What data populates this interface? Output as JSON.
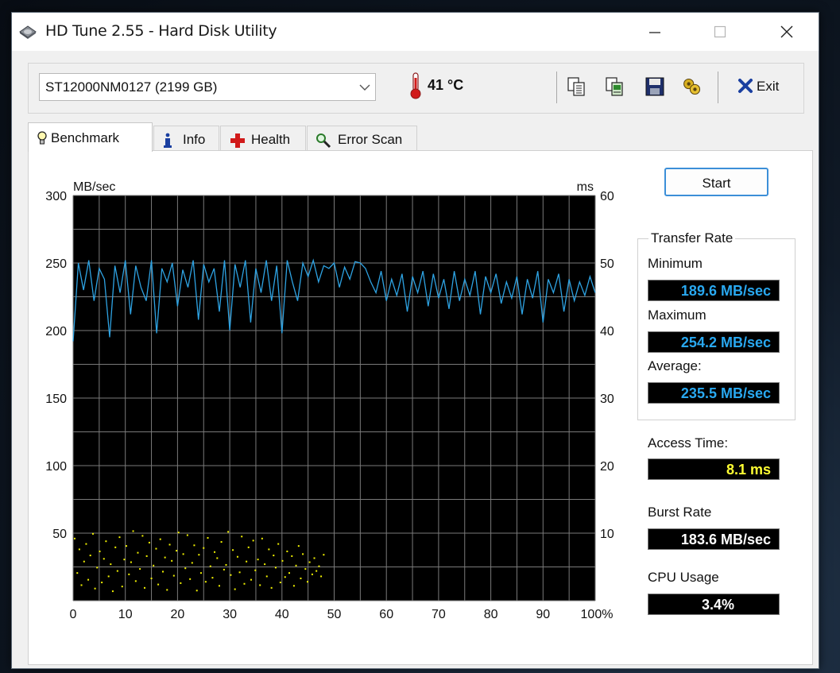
{
  "window": {
    "title": "HD Tune 2.55 - Hard Disk Utility",
    "minimize_glyph": "—",
    "close_glyph": "✕"
  },
  "toolbar": {
    "drive_select": "ST12000NM0127 (2199 GB)",
    "temperature": "41 °C",
    "icons": [
      "copy-text-icon",
      "copy-screenshot-icon",
      "save-icon",
      "options-icon"
    ],
    "exit_label": "Exit"
  },
  "tabs": [
    {
      "label": "Benchmark",
      "icon": "lightbulb-icon",
      "active": true
    },
    {
      "label": "Info",
      "icon": "info-icon",
      "active": false
    },
    {
      "label": "Health",
      "icon": "health-cross-icon",
      "active": false
    },
    {
      "label": "Error Scan",
      "icon": "magnifier-icon",
      "active": false
    }
  ],
  "benchmark": {
    "start_label": "Start",
    "transfer_rate_title": "Transfer Rate",
    "minimum_label": "Minimum",
    "minimum_value": "189.6 MB/sec",
    "maximum_label": "Maximum",
    "maximum_value": "254.2 MB/sec",
    "average_label": "Average:",
    "average_value": "235.5 MB/sec",
    "access_label": "Access Time:",
    "access_value": "8.1 ms",
    "burst_label": "Burst Rate",
    "burst_value": "183.6 MB/sec",
    "cpu_label": "CPU Usage",
    "cpu_value": "3.4%",
    "colors": {
      "transfer_line": "#2ea3e3",
      "access_dots": "#f0f000",
      "rate_values": "#29a8f0",
      "access_value": "#ffff33",
      "plain_values": "#ffffff"
    }
  },
  "chart_data": {
    "type": "line",
    "left_unit": "MB/sec",
    "right_unit": "ms",
    "x_suffix": "%",
    "xlim": [
      0,
      100
    ],
    "ylim": [
      0,
      300
    ],
    "y2lim": [
      0,
      60
    ],
    "x_ticks": [
      0,
      10,
      20,
      30,
      40,
      50,
      60,
      70,
      80,
      90,
      100
    ],
    "y_ticks": [
      50,
      100,
      150,
      200,
      250,
      300
    ],
    "y2_ticks": [
      10,
      20,
      30,
      40,
      50,
      60
    ],
    "grid": true,
    "series": [
      {
        "kind": "line",
        "x": [
          0,
          1,
          2,
          3,
          4,
          5,
          6,
          7,
          8,
          9,
          10,
          11,
          12,
          13,
          14,
          15,
          16,
          17,
          18,
          19,
          20,
          21,
          22,
          23,
          24,
          25,
          26,
          27,
          28,
          29,
          30,
          31,
          32,
          33,
          34,
          35,
          36,
          37,
          38,
          39,
          40,
          41,
          42,
          43,
          44,
          45,
          46,
          47,
          48,
          49,
          50,
          51,
          52,
          53,
          54,
          55,
          56,
          57,
          58,
          59,
          60,
          61,
          62,
          63,
          64,
          65,
          66,
          67,
          68,
          69,
          70,
          71,
          72,
          73,
          74,
          75,
          76,
          77,
          78,
          79,
          80,
          81,
          82,
          83,
          84,
          85,
          86,
          87,
          88,
          89,
          90,
          91,
          92,
          93,
          94,
          95,
          96,
          97,
          98,
          99,
          100
        ],
        "y": [
          192,
          250,
          230,
          252,
          222,
          246,
          238,
          195,
          248,
          228,
          252,
          212,
          248,
          232,
          222,
          252,
          198,
          246,
          236,
          250,
          218,
          245,
          232,
          252,
          208,
          249,
          236,
          246,
          214,
          252,
          200,
          249,
          232,
          252,
          206,
          246,
          228,
          252,
          222,
          248,
          198,
          252,
          236,
          222,
          250,
          240,
          252,
          236,
          248,
          246,
          250,
          232,
          247,
          238,
          251,
          250,
          246,
          236,
          228,
          244,
          222,
          238,
          226,
          242,
          214,
          240,
          228,
          244,
          218,
          242,
          224,
          238,
          216,
          244,
          222,
          238,
          226,
          244,
          212,
          240,
          228,
          242,
          220,
          236,
          224,
          240,
          212,
          238,
          224,
          244,
          206,
          238,
          228,
          242,
          214,
          238,
          222,
          236,
          226,
          240,
          228
        ]
      },
      {
        "kind": "scatter",
        "x": [
          0.3,
          0.8,
          1.2,
          1.6,
          2.1,
          2.5,
          2.9,
          3.3,
          3.8,
          4.2,
          4.6,
          5.1,
          5.5,
          5.9,
          6.3,
          6.8,
          7.2,
          7.6,
          8.1,
          8.5,
          8.9,
          9.4,
          9.8,
          10.2,
          10.7,
          11.1,
          11.5,
          12,
          12.4,
          12.8,
          13.3,
          13.7,
          14.1,
          14.6,
          15,
          15.4,
          15.9,
          16.3,
          16.7,
          17.2,
          17.6,
          18,
          18.5,
          18.9,
          19.3,
          19.8,
          20.2,
          20.6,
          21.1,
          21.5,
          21.9,
          22.4,
          22.8,
          23.2,
          23.7,
          24.1,
          24.5,
          25,
          25.4,
          25.8,
          26.3,
          26.7,
          27.1,
          27.6,
          28,
          28.4,
          28.9,
          29.3,
          29.7,
          30.2,
          30.6,
          31,
          31.5,
          31.9,
          32.3,
          32.8,
          33.2,
          33.6,
          34.1,
          34.5,
          34.9,
          35.4,
          35.8,
          36.2,
          36.7,
          37.1,
          37.5,
          38,
          38.4,
          38.8,
          39.3,
          39.7,
          40.1,
          40.6,
          41,
          41.4,
          41.9,
          42.3,
          42.7,
          43.2,
          43.6,
          44,
          44.5,
          44.9,
          45.3,
          45.8,
          46.2,
          46.6,
          47.1,
          47.5,
          48
        ],
        "y": [
          9.2,
          4.1,
          7.6,
          2.3,
          5.8,
          8.4,
          3.1,
          6.7,
          9.9,
          1.8,
          4.9,
          7.3,
          2.7,
          6.2,
          8.8,
          3.6,
          5.4,
          1.4,
          7.9,
          4.4,
          9.4,
          2.1,
          6.1,
          8.1,
          3.9,
          5.7,
          10.3,
          2.9,
          7.1,
          4.7,
          9.6,
          1.9,
          6.6,
          8.6,
          3.3,
          5.2,
          7.7,
          2.4,
          9.1,
          4.3,
          6.4,
          1.6,
          8.3,
          5.9,
          3.7,
          7.4,
          10.1,
          2.6,
          6.9,
          4.8,
          9.7,
          3.2,
          5.6,
          8.2,
          1.5,
          6.8,
          4.1,
          7.8,
          2.8,
          9.3,
          5.1,
          3.4,
          7.2,
          6.3,
          2.2,
          8.7,
          4.6,
          5.3,
          10.2,
          3.8,
          7.5,
          1.7,
          6.5,
          4.2,
          9.5,
          2.5,
          5.8,
          7.9,
          3.1,
          8.9,
          4.5,
          6.1,
          2.3,
          9.2,
          5.4,
          3.6,
          7.6,
          1.9,
          6.7,
          4.9,
          8.4,
          2.7,
          5.9,
          3.5,
          7.3,
          4.1,
          6.6,
          2.2,
          5.2,
          8.1,
          3.3,
          6.9,
          4.7,
          2.8,
          5.7,
          3.9,
          6.3,
          4.4,
          5.1,
          3.6,
          6.8
        ]
      }
    ]
  }
}
